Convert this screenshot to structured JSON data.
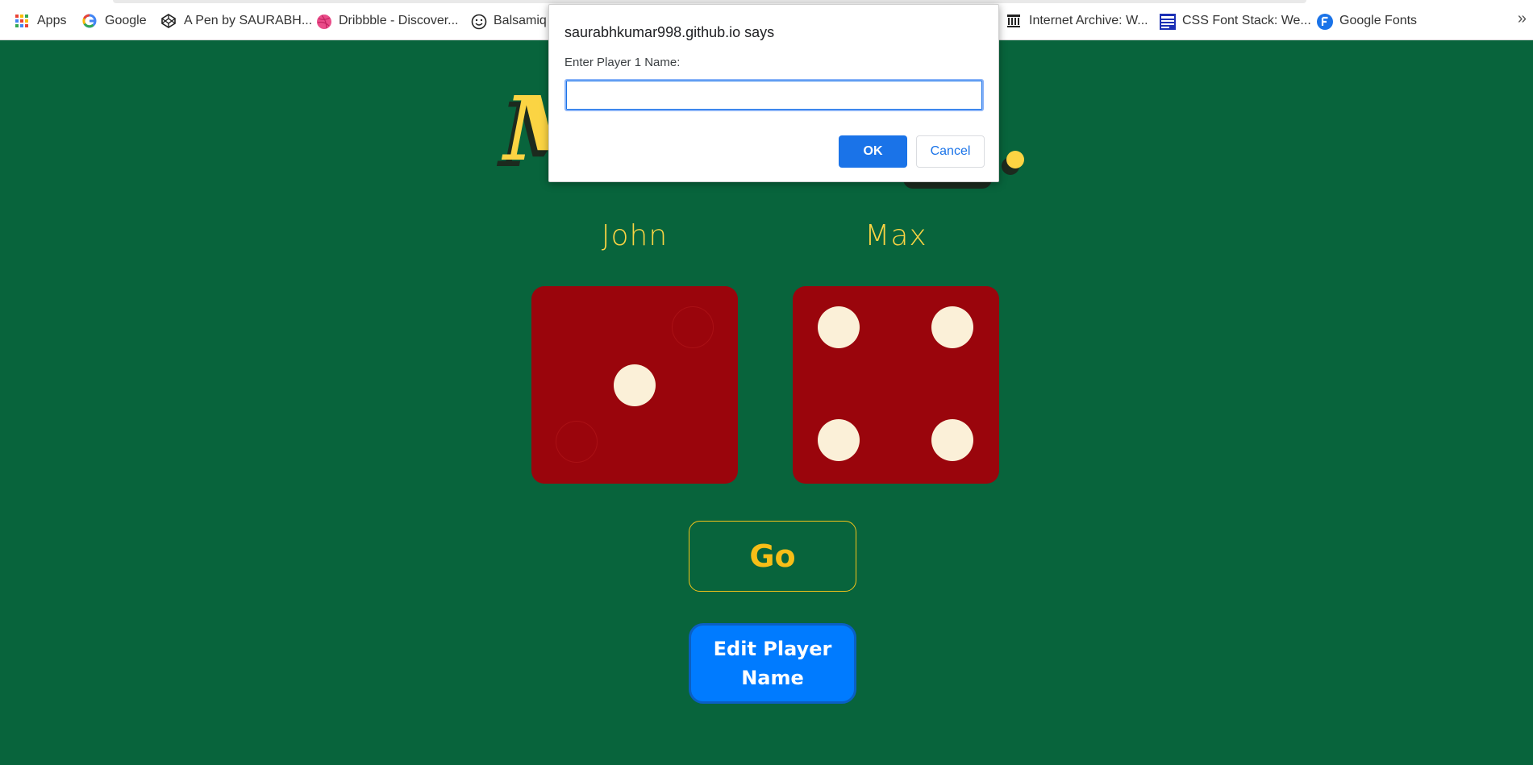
{
  "bookmarks": {
    "items": [
      {
        "label": "Apps",
        "icon": "apps-grid-icon"
      },
      {
        "label": "Google",
        "icon": "google-icon"
      },
      {
        "label": "A Pen by SAURABH...",
        "icon": "codepen-icon"
      },
      {
        "label": "Dribbble - Discover...",
        "icon": "dribbble-icon"
      },
      {
        "label": "Balsamiq",
        "icon": "smiley-icon"
      },
      {
        "label": "Internet Archive: W...",
        "icon": "archive-icon"
      },
      {
        "label": "CSS Font Stack: We...",
        "icon": "css-font-stack-icon"
      },
      {
        "label": "Google Fonts",
        "icon": "google-fonts-icon"
      }
    ],
    "overflow": "»"
  },
  "page": {
    "title_visible": "M",
    "players": [
      {
        "name": "John",
        "die_value": 1
      },
      {
        "name": "Max",
        "die_value": 4
      }
    ],
    "go_label": "Go",
    "edit_label": "Edit Player Name"
  },
  "dialog": {
    "origin": "saurabhkumar998.github.io says",
    "message": "Enter Player 1 Name:",
    "input_value": "",
    "ok_label": "OK",
    "cancel_label": "Cancel"
  },
  "colors": {
    "background": "#08643c",
    "accent_yellow": "#fbd443",
    "die_red": "#9a050c",
    "pip": "#fbf0d8",
    "button_blue": "#007bff",
    "dialog_blue": "#1a73e8"
  }
}
